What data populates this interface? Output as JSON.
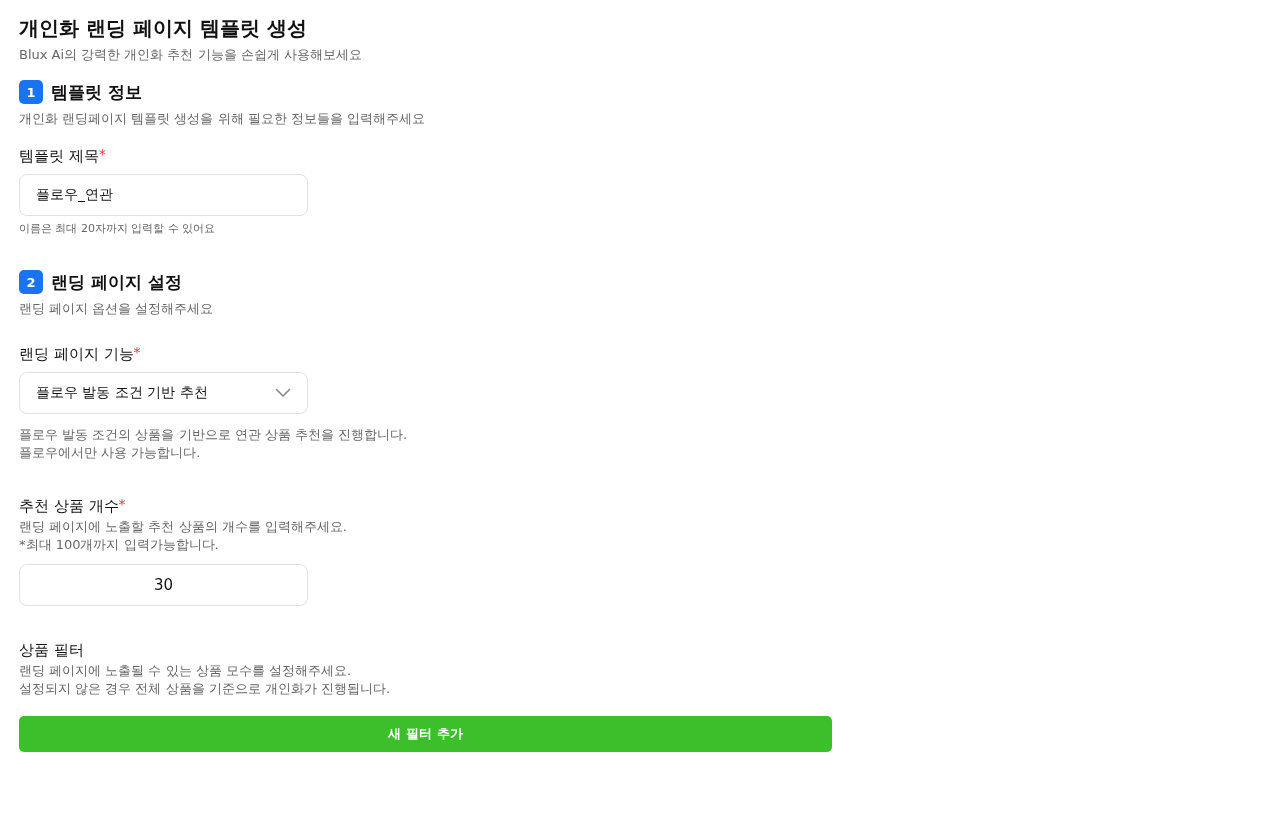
{
  "page": {
    "title": "개인화 랜딩 페이지 템플릿 생성",
    "subtitle": "Blux Ai의 강력한 개인화 추천 기능을 손쉽게 사용해보세요"
  },
  "sections": [
    {
      "number": "1",
      "title": "템플릿 정보",
      "description": "개인화 랜딩페이지 템플릿 생성을 위해 필요한 정보들을 입력해주세요",
      "fields": [
        {
          "kind": "text",
          "label": "템플릿 제목",
          "marker": "*",
          "value": "플로우_연관",
          "notes": [
            "이름은 최대 20자까지 입력할 수 있어요"
          ]
        }
      ]
    },
    {
      "number": "2",
      "title": "랜딩 페이지 설정",
      "description": "랜딩 페이지 옵션을 설정해주세요",
      "fields": [
        {
          "kind": "select",
          "label": "랜딩 페이지 기능",
          "marker": "*",
          "value": "플로우 발동 조건 기반 추천",
          "notes": [
            "플로우 발동 조건의 상품을 기반으로 연관 상품 추천을 진행합니다.",
            "플로우에서만 사용 가능합니다."
          ]
        },
        {
          "kind": "number",
          "label": "추천 상품 개수",
          "marker": "*",
          "descriptions": [
            "랜딩 페이지에 노출할 추천 상품의 개수를 입력해주세요.",
            "*최대 100개까지 입력가능합니다."
          ],
          "value": "30"
        },
        {
          "kind": "action",
          "label": "상품 필터",
          "descriptions": [
            "랜딩 페이지에 노출될 수 있는 상품 모수를 설정해주세요.",
            "설정되지 않은 경우 전체 상품을 기준으로 개인화가 진행됩니다."
          ],
          "button": "새 필터 추가"
        }
      ]
    }
  ]
}
